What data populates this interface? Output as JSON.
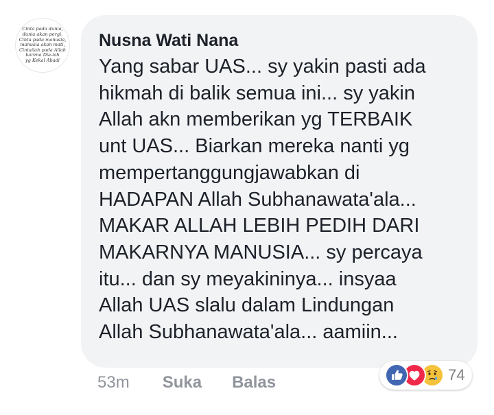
{
  "comment": {
    "avatar_text": [
      "Cinta pada dunia,",
      "dunia akan pergi,",
      "Cinta pada manusia,",
      "manusia akan mati,",
      "Cintailah pada Allah",
      "karena Dia-lah",
      "yg Kekal Abadi"
    ],
    "author": "Nusna Wati Nana",
    "lines": [
      "Yang sabar UAS... sy yakin pasti ada",
      "hikmah di balik semua ini...  sy yakin",
      "Allah akn memberikan yg TERBAIK",
      "unt UAS... Biarkan mereka nanti yg",
      "mempertanggungjawabkan di",
      "HADAPAN Allah Subhanawata'ala...",
      "MAKAR ALLAH LEBIH PEDIH DARI",
      "MAKARNYA MANUSIA... sy percaya",
      "itu... dan sy meyakininya... insyaa",
      "Allah UAS slalu dalam Lindungan",
      "Allah Subhanawata'ala... aamiin..."
    ]
  },
  "actions": {
    "time": "53m",
    "like_label": "Suka",
    "reply_label": "Balas"
  },
  "reactions": {
    "icons": [
      "like-icon",
      "love-icon",
      "sad-icon"
    ],
    "count": "74",
    "colors": {
      "like": "#4267b2",
      "love": "#f0284a",
      "sad": "#f5c33b"
    }
  }
}
